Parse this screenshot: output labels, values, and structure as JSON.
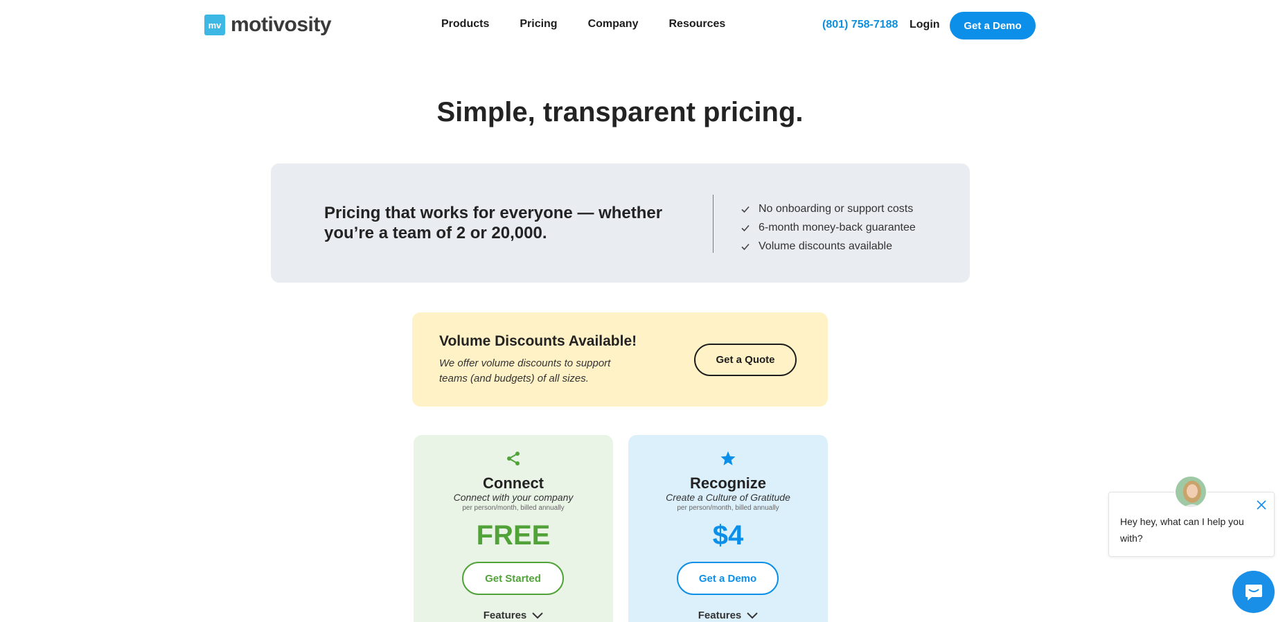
{
  "brand": {
    "logo_mark": "mv",
    "logo_text": "motivosity"
  },
  "nav": {
    "items": [
      "Products",
      "Pricing",
      "Company",
      "Resources"
    ]
  },
  "header": {
    "phone": "(801) 758-7188",
    "login": "Login",
    "demo_label": "Get a Demo"
  },
  "page_title": "Simple, transparent pricing.",
  "info": {
    "heading": "Pricing that works for everyone — whether you’re a team of 2 or 20,000.",
    "bullets": [
      "No onboarding or support costs",
      "6-month money-back guarantee",
      "Volume discounts available"
    ]
  },
  "volume": {
    "title": "Volume Discounts Available!",
    "description": "We offer volume discounts to support teams (and budgets) of all sizes.",
    "button": "Get a Quote"
  },
  "plans": [
    {
      "icon": "share-icon",
      "name": "Connect",
      "tagline": "Connect with your company",
      "billing": "per person/month, billed annually",
      "price": "FREE",
      "button": "Get Started",
      "features": "Features",
      "color": "#52a23a"
    },
    {
      "icon": "star-icon",
      "name": "Recognize",
      "tagline": "Create a Culture of Gratitude",
      "billing": "per person/month, billed annually",
      "price": "$4",
      "button": "Get a Demo",
      "features": "Features",
      "color": "#0b8fe8"
    }
  ],
  "chat": {
    "message": "Hey hey, what can I help you with?"
  },
  "colors": {
    "accent": "#0b8fe8",
    "connect_green": "#52a23a",
    "info_bg": "#e9ecf1",
    "volume_bg": "#fff2c6"
  }
}
